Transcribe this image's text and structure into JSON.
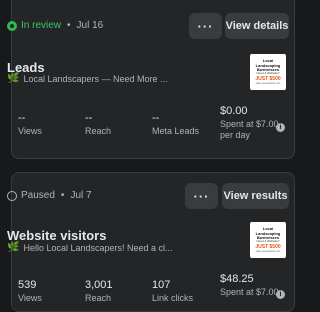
{
  "ads": [
    {
      "status": "In review",
      "date": "Jul 16",
      "more_label": "···",
      "action_label": "View details",
      "title": "Leads",
      "subtitle": "Local Landscapers — Need More ...",
      "thumb": {
        "line1": "Local Landscaping",
        "line2": "Businesses",
        "line3": "Need A Website?",
        "price": "JUST $500",
        "line5": "www.yourwebsite.com"
      },
      "metrics": [
        {
          "value": "--",
          "label": "Views"
        },
        {
          "value": "--",
          "label": "Reach"
        },
        {
          "value": "--",
          "label": "Meta Leads"
        }
      ],
      "spend": {
        "value": "$0.00",
        "label_line1": "Spent at $7.00",
        "label_line2": "per day"
      }
    },
    {
      "status": "Paused",
      "date": "Jul 7",
      "more_label": "···",
      "action_label": "View results",
      "title": "Website visitors",
      "subtitle": "Hello Local Landscapers! Need a cl...",
      "thumb": {
        "line1": "Local Landscaping",
        "line2": "Businesses",
        "line3": "Need A Website?",
        "price": "JUST $500",
        "line5": "www.yourwebsite.com"
      },
      "metrics": [
        {
          "value": "539",
          "label": "Views"
        },
        {
          "value": "3,001",
          "label": "Reach"
        },
        {
          "value": "107",
          "label": "Link clicks"
        }
      ],
      "spend": {
        "value": "$48.25",
        "label_line1": "Spent at $7.00",
        "label_line2": ""
      }
    }
  ]
}
